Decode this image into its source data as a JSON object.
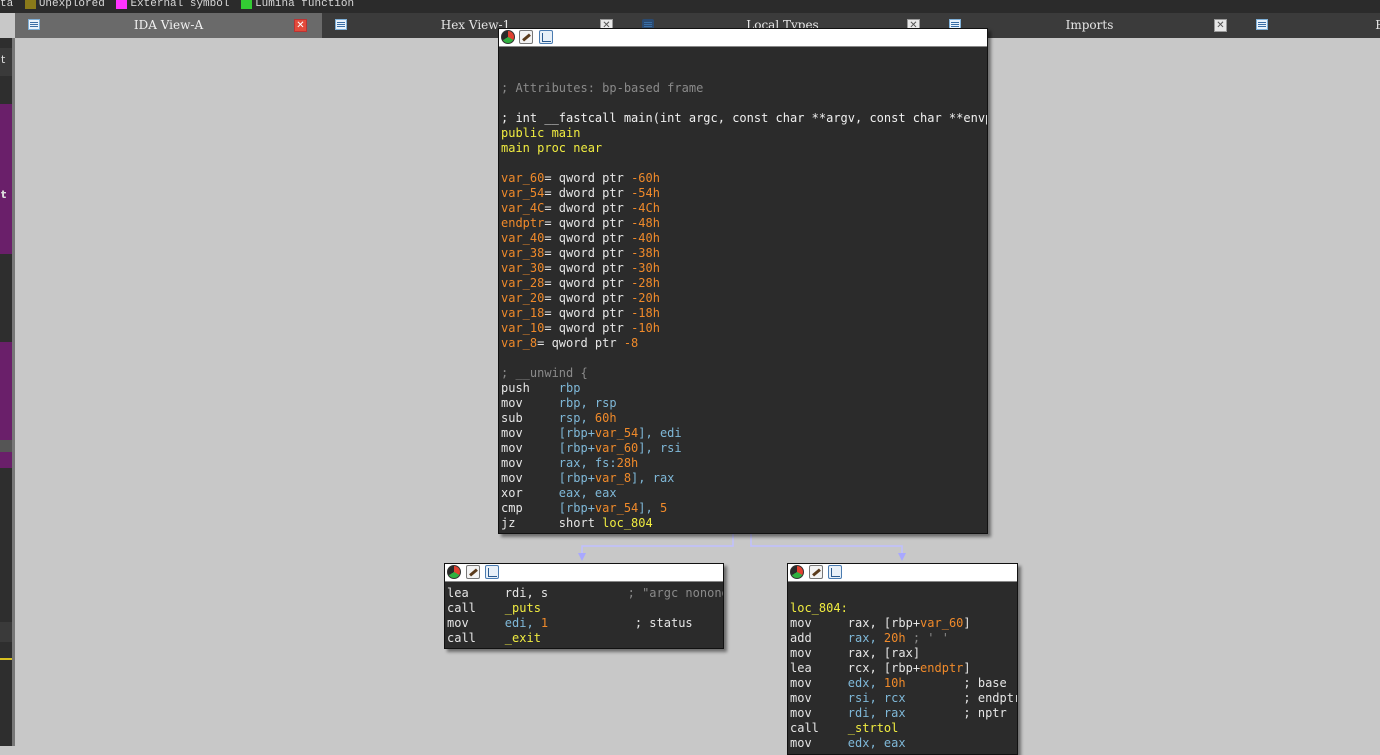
{
  "legend": [
    {
      "label": "ta",
      "color": ""
    },
    {
      "label": "Unexplored",
      "color": "#8a7a1a"
    },
    {
      "label": "External symbol",
      "color": "#ff33ff"
    },
    {
      "label": "Lumina function",
      "color": "#33cc33"
    }
  ],
  "tabs": [
    {
      "label": "IDA View-A",
      "icon": "listing-icon",
      "active": true
    },
    {
      "label": "Hex View-1",
      "icon": "hex-icon",
      "active": false
    },
    {
      "label": "Local Types",
      "icon": "types-icon",
      "active": false
    },
    {
      "label": "Imports",
      "icon": "imports-icon",
      "active": false
    },
    {
      "label": "E",
      "icon": "exports-icon",
      "active": false
    }
  ],
  "left_strip": {
    "chars": [
      "t",
      "t"
    ],
    "colors": [
      "#6a1f6a",
      "#6a1f6a"
    ]
  },
  "colors": {
    "background": "#c8c8c8",
    "node": "#2b2b2b",
    "comment": "#8a8a8a",
    "name": "#f0ec40",
    "var": "#f08a2a",
    "reg": "#7fb8d8",
    "edge": "#a8a8ff"
  },
  "main_block": {
    "lines": [
      [],
      [],
      [
        {
          "t": "; Attributes: bp-based frame",
          "c": "cmt"
        }
      ],
      [],
      [
        {
          "t": "; int __fastcall main(int argc, const char **argv, const char **envp)",
          "c": "sig"
        }
      ],
      [
        {
          "t": "public ",
          "c": "kw"
        },
        {
          "t": "main",
          "c": "name"
        }
      ],
      [
        {
          "t": "main",
          "c": "name"
        },
        {
          "t": " proc near",
          "c": "kw"
        }
      ],
      [],
      [
        {
          "t": "var_60",
          "c": "var"
        },
        {
          "t": "= qword ptr ",
          "c": "plain"
        },
        {
          "t": "-60h",
          "c": "num"
        }
      ],
      [
        {
          "t": "var_54",
          "c": "var"
        },
        {
          "t": "= dword ptr ",
          "c": "plain"
        },
        {
          "t": "-54h",
          "c": "num"
        }
      ],
      [
        {
          "t": "var_4C",
          "c": "var"
        },
        {
          "t": "= dword ptr ",
          "c": "plain"
        },
        {
          "t": "-4Ch",
          "c": "num"
        }
      ],
      [
        {
          "t": "endptr",
          "c": "var"
        },
        {
          "t": "= qword ptr ",
          "c": "plain"
        },
        {
          "t": "-48h",
          "c": "num"
        }
      ],
      [
        {
          "t": "var_40",
          "c": "var"
        },
        {
          "t": "= qword ptr ",
          "c": "plain"
        },
        {
          "t": "-40h",
          "c": "num"
        }
      ],
      [
        {
          "t": "var_38",
          "c": "var"
        },
        {
          "t": "= qword ptr ",
          "c": "plain"
        },
        {
          "t": "-38h",
          "c": "num"
        }
      ],
      [
        {
          "t": "var_30",
          "c": "var"
        },
        {
          "t": "= qword ptr ",
          "c": "plain"
        },
        {
          "t": "-30h",
          "c": "num"
        }
      ],
      [
        {
          "t": "var_28",
          "c": "var"
        },
        {
          "t": "= qword ptr ",
          "c": "plain"
        },
        {
          "t": "-28h",
          "c": "num"
        }
      ],
      [
        {
          "t": "var_20",
          "c": "var"
        },
        {
          "t": "= qword ptr ",
          "c": "plain"
        },
        {
          "t": "-20h",
          "c": "num"
        }
      ],
      [
        {
          "t": "var_18",
          "c": "var"
        },
        {
          "t": "= qword ptr ",
          "c": "plain"
        },
        {
          "t": "-18h",
          "c": "num"
        }
      ],
      [
        {
          "t": "var_10",
          "c": "var"
        },
        {
          "t": "= qword ptr ",
          "c": "plain"
        },
        {
          "t": "-10h",
          "c": "num"
        }
      ],
      [
        {
          "t": "var_8",
          "c": "var"
        },
        {
          "t": "= qword ptr ",
          "c": "plain"
        },
        {
          "t": "-8",
          "c": "num"
        }
      ],
      [],
      [
        {
          "t": "; __unwind {",
          "c": "cmt"
        }
      ],
      [
        {
          "t": "push    ",
          "c": "mn"
        },
        {
          "t": "rbp",
          "c": "reg"
        }
      ],
      [
        {
          "t": "mov     ",
          "c": "mn"
        },
        {
          "t": "rbp, rsp",
          "c": "reg"
        }
      ],
      [
        {
          "t": "sub     ",
          "c": "mn"
        },
        {
          "t": "rsp, ",
          "c": "reg"
        },
        {
          "t": "60h",
          "c": "num"
        }
      ],
      [
        {
          "t": "mov     ",
          "c": "mn"
        },
        {
          "t": "[rbp+",
          "c": "reg"
        },
        {
          "t": "var_54",
          "c": "var"
        },
        {
          "t": "], edi",
          "c": "reg"
        }
      ],
      [
        {
          "t": "mov     ",
          "c": "mn"
        },
        {
          "t": "[rbp+",
          "c": "reg"
        },
        {
          "t": "var_60",
          "c": "var"
        },
        {
          "t": "], rsi",
          "c": "reg"
        }
      ],
      [
        {
          "t": "mov     ",
          "c": "mn"
        },
        {
          "t": "rax, fs:",
          "c": "reg"
        },
        {
          "t": "28h",
          "c": "num"
        }
      ],
      [
        {
          "t": "mov     ",
          "c": "mn"
        },
        {
          "t": "[rbp+",
          "c": "reg"
        },
        {
          "t": "var_8",
          "c": "var"
        },
        {
          "t": "], rax",
          "c": "reg"
        }
      ],
      [
        {
          "t": "xor     ",
          "c": "mn"
        },
        {
          "t": "eax, eax",
          "c": "reg"
        }
      ],
      [
        {
          "t": "cmp     ",
          "c": "mn"
        },
        {
          "t": "[rbp+",
          "c": "reg"
        },
        {
          "t": "var_54",
          "c": "var"
        },
        {
          "t": "], ",
          "c": "reg"
        },
        {
          "t": "5",
          "c": "num"
        }
      ],
      [
        {
          "t": "jz      ",
          "c": "mn"
        },
        {
          "t": "short ",
          "c": "plain"
        },
        {
          "t": "loc_804",
          "c": "lbl"
        }
      ]
    ]
  },
  "left_block": {
    "lines": [
      [
        {
          "t": "lea     ",
          "c": "mn"
        },
        {
          "t": "rdi, s",
          "c": "warg"
        },
        {
          "t": "           ; \"argc nonono\"",
          "c": "str"
        }
      ],
      [
        {
          "t": "call    ",
          "c": "mn"
        },
        {
          "t": "_puts",
          "c": "lbl"
        }
      ],
      [
        {
          "t": "mov     ",
          "c": "mn"
        },
        {
          "t": "edi, ",
          "c": "reg"
        },
        {
          "t": "1",
          "c": "num"
        },
        {
          "t": "            ; status",
          "c": "plain"
        }
      ],
      [
        {
          "t": "call    ",
          "c": "mn"
        },
        {
          "t": "_exit",
          "c": "lbl"
        }
      ]
    ]
  },
  "right_block": {
    "lines": [
      [],
      [
        {
          "t": "loc_804:",
          "c": "lbl"
        }
      ],
      [
        {
          "t": "mov     ",
          "c": "mn"
        },
        {
          "t": "rax, [rbp+",
          "c": "warg"
        },
        {
          "t": "var_60",
          "c": "var"
        },
        {
          "t": "]",
          "c": "warg"
        }
      ],
      [
        {
          "t": "add     ",
          "c": "mn"
        },
        {
          "t": "rax, ",
          "c": "reg"
        },
        {
          "t": "20h",
          "c": "num"
        },
        {
          "t": " ; ' '",
          "c": "str"
        }
      ],
      [
        {
          "t": "mov     ",
          "c": "mn"
        },
        {
          "t": "rax, [rax]",
          "c": "warg"
        }
      ],
      [
        {
          "t": "lea     ",
          "c": "mn"
        },
        {
          "t": "rcx, [rbp+",
          "c": "warg"
        },
        {
          "t": "endptr",
          "c": "var"
        },
        {
          "t": "]",
          "c": "warg"
        }
      ],
      [
        {
          "t": "mov     ",
          "c": "mn"
        },
        {
          "t": "edx, ",
          "c": "reg"
        },
        {
          "t": "10h",
          "c": "num"
        },
        {
          "t": "        ; base",
          "c": "plain"
        }
      ],
      [
        {
          "t": "mov     ",
          "c": "mn"
        },
        {
          "t": "rsi, rcx",
          "c": "reg"
        },
        {
          "t": "        ; endptr",
          "c": "plain"
        }
      ],
      [
        {
          "t": "mov     ",
          "c": "mn"
        },
        {
          "t": "rdi, rax",
          "c": "reg"
        },
        {
          "t": "        ; nptr",
          "c": "plain"
        }
      ],
      [
        {
          "t": "call    ",
          "c": "mn"
        },
        {
          "t": "_strtol",
          "c": "lbl"
        }
      ],
      [
        {
          "t": "mov     ",
          "c": "mn"
        },
        {
          "t": "edx, eax",
          "c": "reg"
        }
      ]
    ]
  }
}
